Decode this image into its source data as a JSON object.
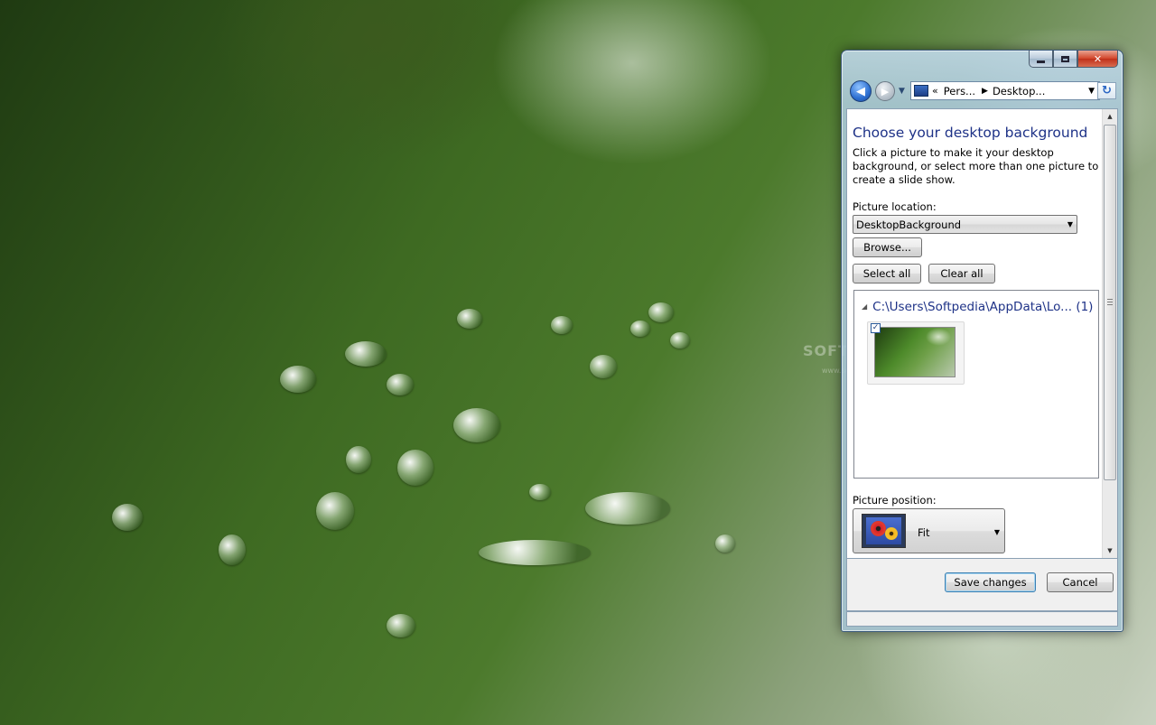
{
  "window": {
    "address": {
      "overflow": "«",
      "crumb1": "Pers...",
      "crumb2": "Desktop..."
    },
    "title": "Choose your desktop background",
    "description": "Click a picture to make it your desktop background, or select more than one picture to create a slide show.",
    "picture_location": {
      "label": "Picture location:",
      "value": "DesktopBackground"
    },
    "buttons": {
      "browse": "Browse...",
      "select_all": "Select all",
      "clear_all": "Clear all",
      "save": "Save changes",
      "cancel": "Cancel"
    },
    "gallery": {
      "group_path": "C:\\Users\\Softpedia\\AppData\\Lo...",
      "group_count": "(1)",
      "items": [
        {
          "checked": true
        }
      ]
    },
    "picture_position": {
      "label": "Picture position:",
      "value": "Fit"
    }
  },
  "desktop": {
    "watermark": "SOFTPEDIA",
    "watermark_small": "www.softpedia.com"
  },
  "colors": {
    "heading": "#1e3287",
    "window_frame": "#aac8d7",
    "close_button": "#c0301a"
  },
  "icons": {
    "back": "left-arrow",
    "forward": "right-arrow",
    "refresh": "refresh",
    "address": "control-panel"
  }
}
